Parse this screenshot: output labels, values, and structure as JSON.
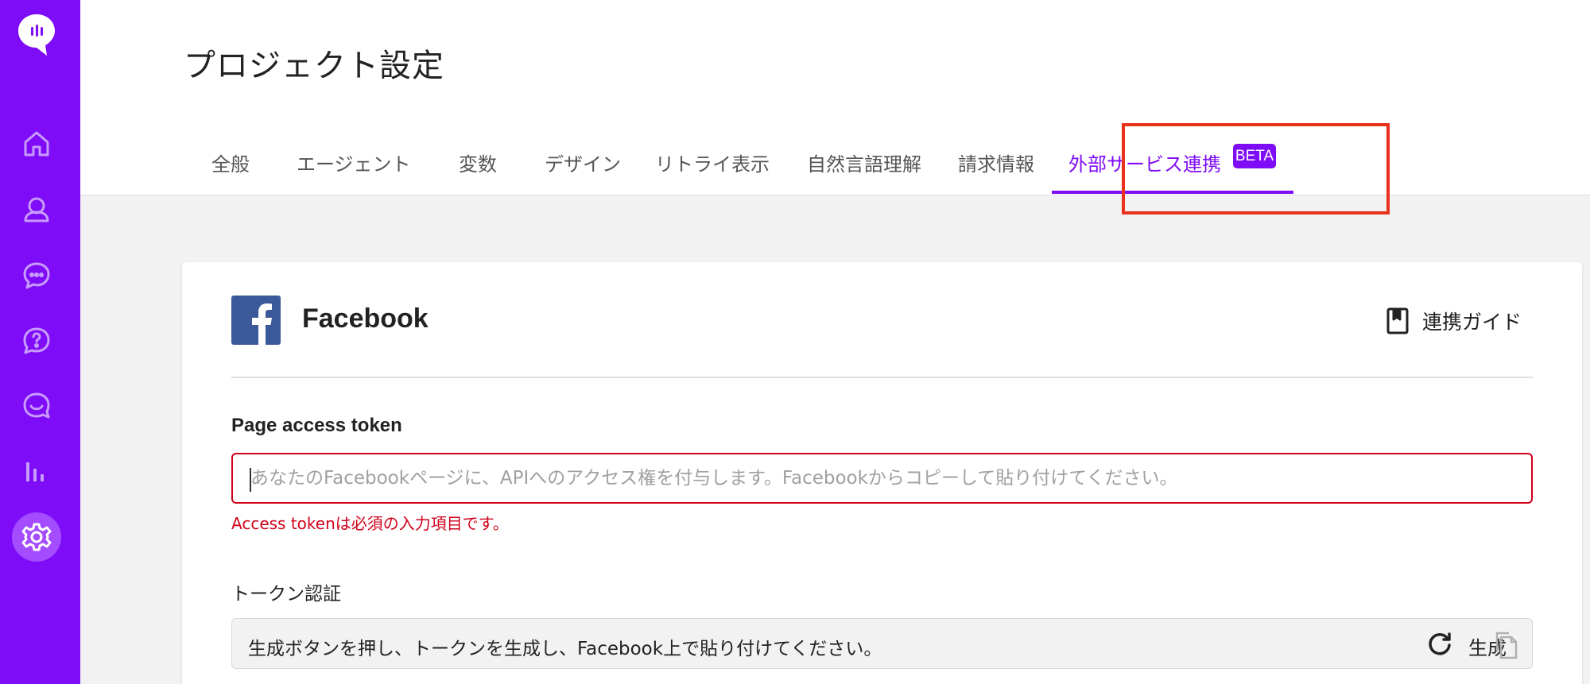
{
  "page_title": "プロジェクト設定",
  "tabs": [
    {
      "label": "全般"
    },
    {
      "label": "エージェント"
    },
    {
      "label": "変数"
    },
    {
      "label": "デザイン"
    },
    {
      "label": "リトライ表示"
    },
    {
      "label": "自然言語理解"
    },
    {
      "label": "請求情報"
    },
    {
      "label": "外部サービス連携",
      "badge": "BETA",
      "active": true
    }
  ],
  "card": {
    "title": "Facebook",
    "guide_label": "連携ガイド",
    "page_access_token": {
      "label": "Page access token",
      "value": "",
      "placeholder": "あなたのFacebookページに、APIへのアクセス権を付与します。Facebookからコピーして貼り付けてください。",
      "error": "Access tokenは必須の入力項目です。"
    },
    "token_verification": {
      "label": "トークン認証",
      "text": "生成ボタンを押し、トークンを生成し、Facebook上で貼り付けてください。",
      "generate_label": "生成"
    }
  },
  "colors": {
    "brand": "#7f0cf6",
    "error": "#d0021b",
    "highlight": "#e8321e",
    "facebook": "#3b5998"
  },
  "icons": {
    "sidebar": [
      "logo-icon",
      "home-icon",
      "user-icon",
      "chat-icon",
      "help-icon",
      "message-icon",
      "analytics-icon",
      "settings-icon"
    ],
    "guide": "book-icon",
    "generate": "refresh-icon",
    "copy": "copy-icon"
  }
}
